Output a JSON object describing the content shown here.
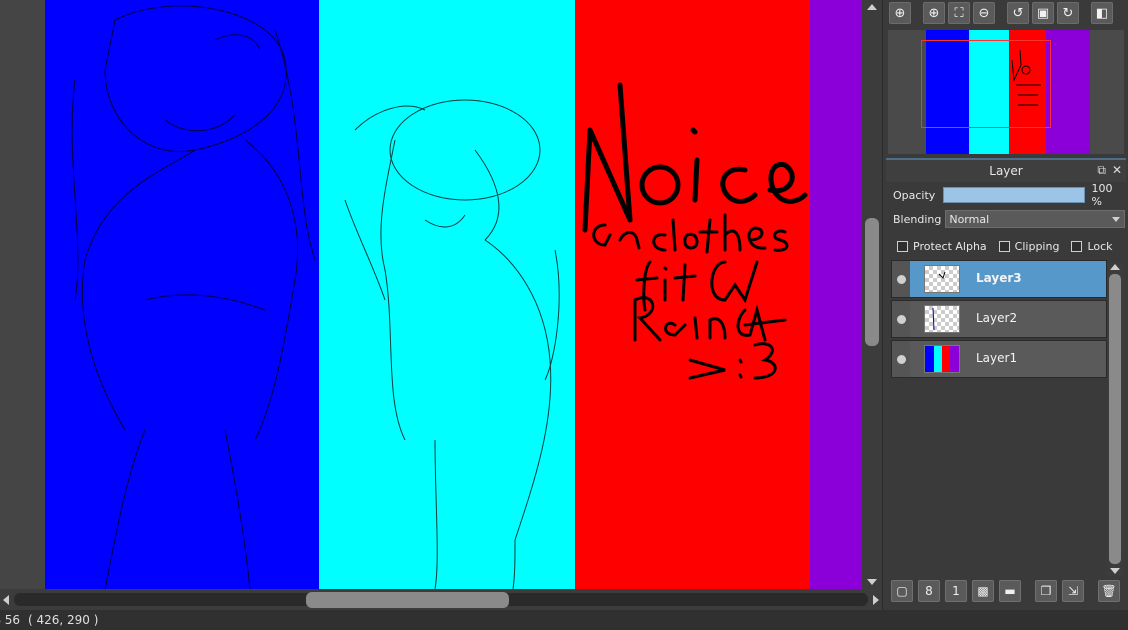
{
  "canvas": {
    "stripes": [
      {
        "color": "#0000ff"
      },
      {
        "color": "#00ffff"
      },
      {
        "color": "#ff0000"
      },
      {
        "color": "#8b00d9"
      }
    ],
    "handwriting_text": "Noice Gra clothes fit GA Rain >:3",
    "sketch_color": "#000000"
  },
  "status": {
    "zoom": "56 %",
    "coords": "( 426, 290 )"
  },
  "navigator_toolbar": [
    {
      "name": "zoom-fit-icon",
      "glyph": "⊕"
    },
    {
      "name": "zoom-in-icon",
      "glyph": "⊕"
    },
    {
      "name": "fit-screen-icon",
      "glyph": "⛶"
    },
    {
      "name": "zoom-out-icon",
      "glyph": "⊖"
    },
    {
      "name": "rotate-left-icon",
      "glyph": "↺"
    },
    {
      "name": "reset-view-icon",
      "glyph": "▣"
    },
    {
      "name": "rotate-right-icon",
      "glyph": "↻"
    },
    {
      "name": "flip-icon",
      "glyph": "◧"
    }
  ],
  "layer_panel": {
    "title": "Layer",
    "opacity_label": "Opacity",
    "opacity_value": "100 %",
    "opacity_fraction": 1.0,
    "blending_label": "Blending",
    "blending_value": "Normal",
    "protect_alpha": "Protect Alpha",
    "clipping": "Clipping",
    "lock": "Lock",
    "layers": [
      {
        "name": "Layer3",
        "selected": true
      },
      {
        "name": "Layer2",
        "selected": false
      },
      {
        "name": "Layer1",
        "selected": false
      }
    ]
  },
  "layer_toolbar": [
    {
      "name": "new-layer-icon",
      "glyph": "▢"
    },
    {
      "name": "new-8bit-layer-icon",
      "glyph": "8"
    },
    {
      "name": "new-1bit-layer-icon",
      "glyph": "1"
    },
    {
      "name": "new-halftone-layer-icon",
      "glyph": "▩"
    },
    {
      "name": "new-folder-icon",
      "glyph": "▬"
    },
    {
      "name": "duplicate-layer-icon",
      "glyph": "❐"
    },
    {
      "name": "merge-down-icon",
      "glyph": "⇲"
    },
    {
      "name": "delete-layer-icon",
      "glyph": "🗑"
    }
  ]
}
